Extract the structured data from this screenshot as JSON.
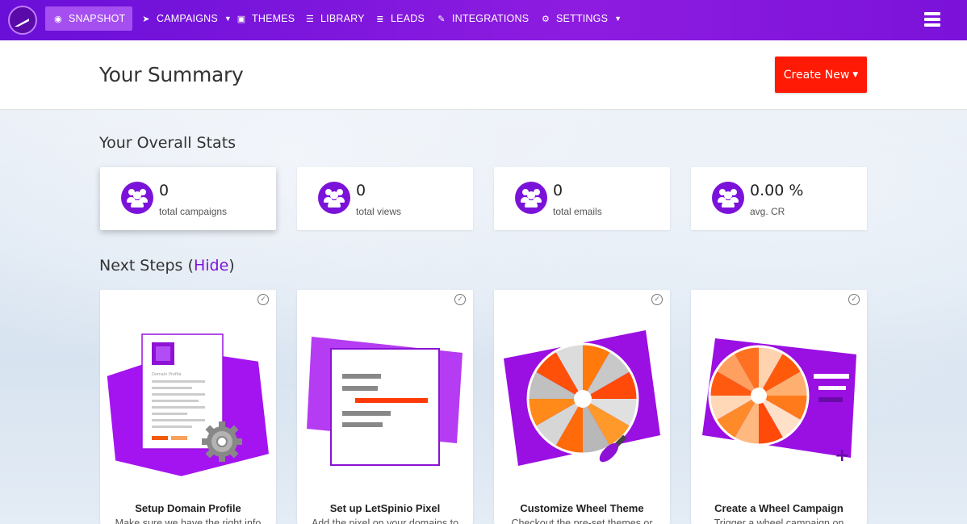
{
  "nav": {
    "items": [
      {
        "label": "SNAPSHOT",
        "icon": "dashboard-icon",
        "active": true
      },
      {
        "label": "CAMPAIGNS",
        "icon": "paper-plane-icon",
        "dropdown": true
      },
      {
        "label": "THEMES",
        "icon": "image-icon"
      },
      {
        "label": "LIBRARY",
        "icon": "library-icon"
      },
      {
        "label": "LEADS",
        "icon": "list-icon"
      },
      {
        "label": "INTEGRATIONS",
        "icon": "plug-icon"
      },
      {
        "label": "SETTINGS",
        "icon": "gears-icon",
        "dropdown": true
      }
    ],
    "accent_color": "#7b12d9"
  },
  "header": {
    "title": "Your Summary",
    "create_button": "Create New",
    "create_button_color": "#ff1a05"
  },
  "stats": {
    "title": "Your Overall Stats",
    "cards": [
      {
        "value": "0",
        "label": "total campaigns",
        "icon": "users-icon"
      },
      {
        "value": "0",
        "label": "total views",
        "icon": "users-icon"
      },
      {
        "value": "0",
        "label": "total emails",
        "icon": "users-icon"
      },
      {
        "value": "0.00 %",
        "label": "avg. CR",
        "icon": "users-icon"
      }
    ]
  },
  "next_steps": {
    "title": "Next Steps",
    "hide_open": "(",
    "hide_label": "Hide",
    "hide_close": ")",
    "cards": [
      {
        "title": "Setup Domain Profile",
        "description": "Make sure we have the right info",
        "illustration_label": "Domain Profile"
      },
      {
        "title": "Set up LetSpinio Pixel",
        "description": "Add the pixel on your domains to"
      },
      {
        "title": "Customize Wheel Theme",
        "description": "Checkout the pre-set themes or"
      },
      {
        "title": "Create a Wheel Campaign",
        "description": "Trigger a wheel campaign on"
      }
    ]
  }
}
